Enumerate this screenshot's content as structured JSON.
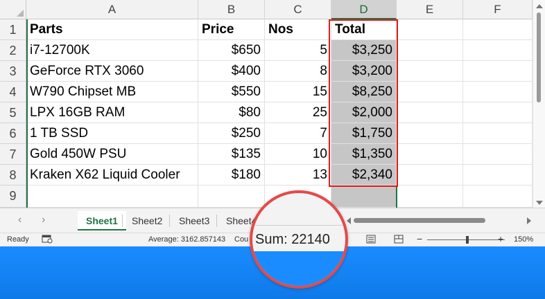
{
  "columns": [
    "A",
    "B",
    "C",
    "D",
    "E",
    "F"
  ],
  "rows": [
    "1",
    "2",
    "3",
    "4",
    "5",
    "6",
    "7",
    "8",
    "9"
  ],
  "table": {
    "headers": [
      "Parts",
      "Price",
      "Nos",
      "Total"
    ],
    "data": [
      [
        "i7-12700K",
        "$650",
        "5",
        "$3,250"
      ],
      [
        "GeForce RTX 3060",
        "$400",
        "8",
        "$3,200"
      ],
      [
        "W790 Chipset MB",
        "$550",
        "15",
        "$8,250"
      ],
      [
        "LPX 16GB RAM",
        "$80",
        "25",
        "$2,000"
      ],
      [
        "1 TB SSD",
        "$250",
        "7",
        "$1,750"
      ],
      [
        "Gold 450W PSU",
        "$135",
        "10",
        "$1,350"
      ],
      [
        "Kraken X62 Liquid Cooler",
        "$180",
        "13",
        "$2,340"
      ]
    ]
  },
  "sheets": [
    "Sheet1",
    "Sheet2",
    "Sheet3",
    "Sheet4"
  ],
  "active_sheet": "Sheet1",
  "status": {
    "ready": "Ready",
    "average": "Average: 3162.857143",
    "count_partial": "Cou",
    "sum": "Sum: 22140",
    "zoom": "150%"
  },
  "icons": {
    "nav_prev": "‹",
    "nav_next": "›",
    "add_sheet": "+",
    "more": "…"
  },
  "colors": {
    "accent": "#217346",
    "highlight_border": "#e31b1b",
    "selection_fill": "#c6c6c6",
    "desktop": "#1a8cff"
  }
}
